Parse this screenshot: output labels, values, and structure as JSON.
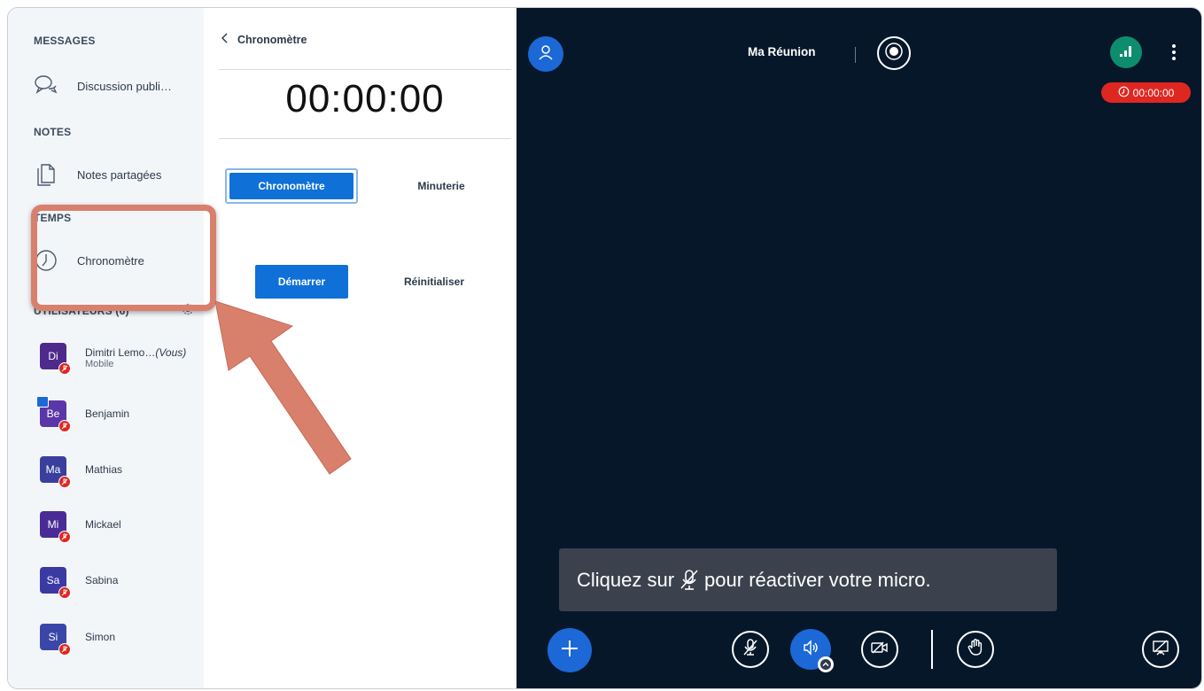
{
  "sidebar": {
    "messages_title": "MESSAGES",
    "public_chat_label": "Discussion publi…",
    "notes_title": "NOTES",
    "shared_notes_label": "Notes partagées",
    "time_title": "TEMPS",
    "stopwatch_label": "Chronomètre",
    "users_title": "UTILISATEURS (6)",
    "users": [
      {
        "initials": "Di",
        "name": "Dimitri Lemo…",
        "you": "(Vous)",
        "sub": "Mobile",
        "color": "#4e2a8c"
      },
      {
        "initials": "Be",
        "name": "Benjamin",
        "color": "#5b36a8"
      },
      {
        "initials": "Ma",
        "name": "Mathias",
        "color": "#3a3f9e"
      },
      {
        "initials": "Mi",
        "name": "Mickael",
        "color": "#4a2b96"
      },
      {
        "initials": "Sa",
        "name": "Sabina",
        "color": "#3b3aa4"
      },
      {
        "initials": "Si",
        "name": "Simon",
        "color": "#3a47a8"
      }
    ]
  },
  "timer_panel": {
    "title": "Chronomètre",
    "display": "00:00:00",
    "tab_stopwatch": "Chronomètre",
    "tab_timer": "Minuterie",
    "start_label": "Démarrer",
    "reset_label": "Réinitialiser"
  },
  "meeting": {
    "title": "Ma Réunion",
    "recording_time": "00:00:00",
    "toast_before": "Cliquez sur",
    "toast_after": "pour réactiver votre micro."
  },
  "colors": {
    "accent": "#0f70d7",
    "meeting_bg": "#06172a",
    "mute_red": "#df2721",
    "connection_green": "#0d8d6d",
    "annotation": "#d9806c"
  },
  "icons": [
    "chat-icon",
    "notes-icon",
    "clock-icon",
    "settings-icon",
    "chevron-left-icon",
    "user-icon",
    "record-icon",
    "connection-icon",
    "more-vert-icon",
    "plus-icon",
    "mic-off-icon",
    "speaker-icon",
    "camera-off-icon",
    "hand-icon",
    "presentation-off-icon"
  ]
}
